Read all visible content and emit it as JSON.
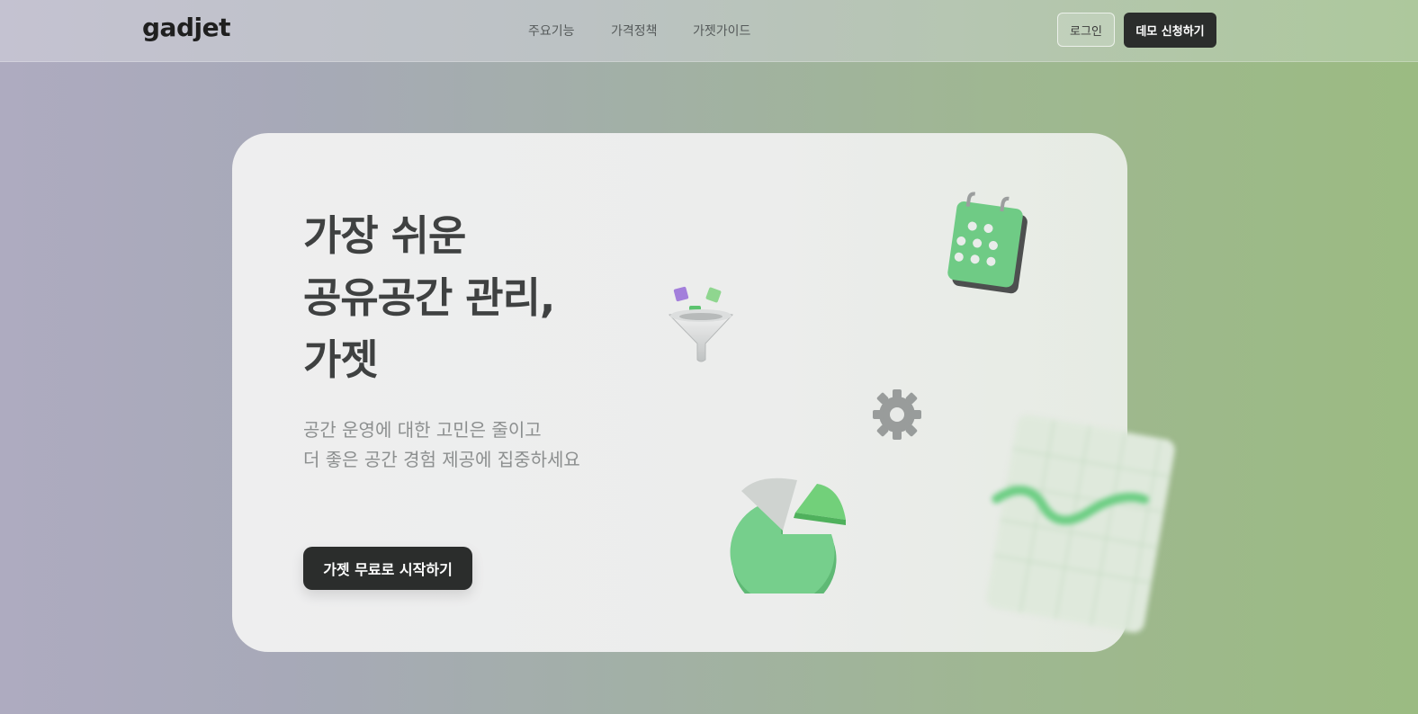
{
  "header": {
    "logo": "gadjet",
    "nav": [
      "주요기능",
      "가격정책",
      "가젯가이드"
    ],
    "login_label": "로그인",
    "demo_label": "데모 신청하기"
  },
  "hero": {
    "headline": [
      "가장 쉬운",
      "공유공간 관리,",
      "가젯"
    ],
    "subtitle": [
      "공간 운영에 대한 고민은 줄이고",
      "더 좋은 공간 경험 제공에 집중하세요"
    ],
    "cta_label": "가젯 무료로 시작하기"
  },
  "illustrations": {
    "icons": [
      "funnel-icon",
      "calendar-icon",
      "gear-icon",
      "pie-chart-icon",
      "line-chart-icon"
    ],
    "accent_green": "#6fcb85",
    "accent_purple": "#a37fdb"
  },
  "colors": {
    "dark_button": "#2b2d2c",
    "headline_text": "#3f4141",
    "subtitle_text": "#8c8f8f"
  }
}
